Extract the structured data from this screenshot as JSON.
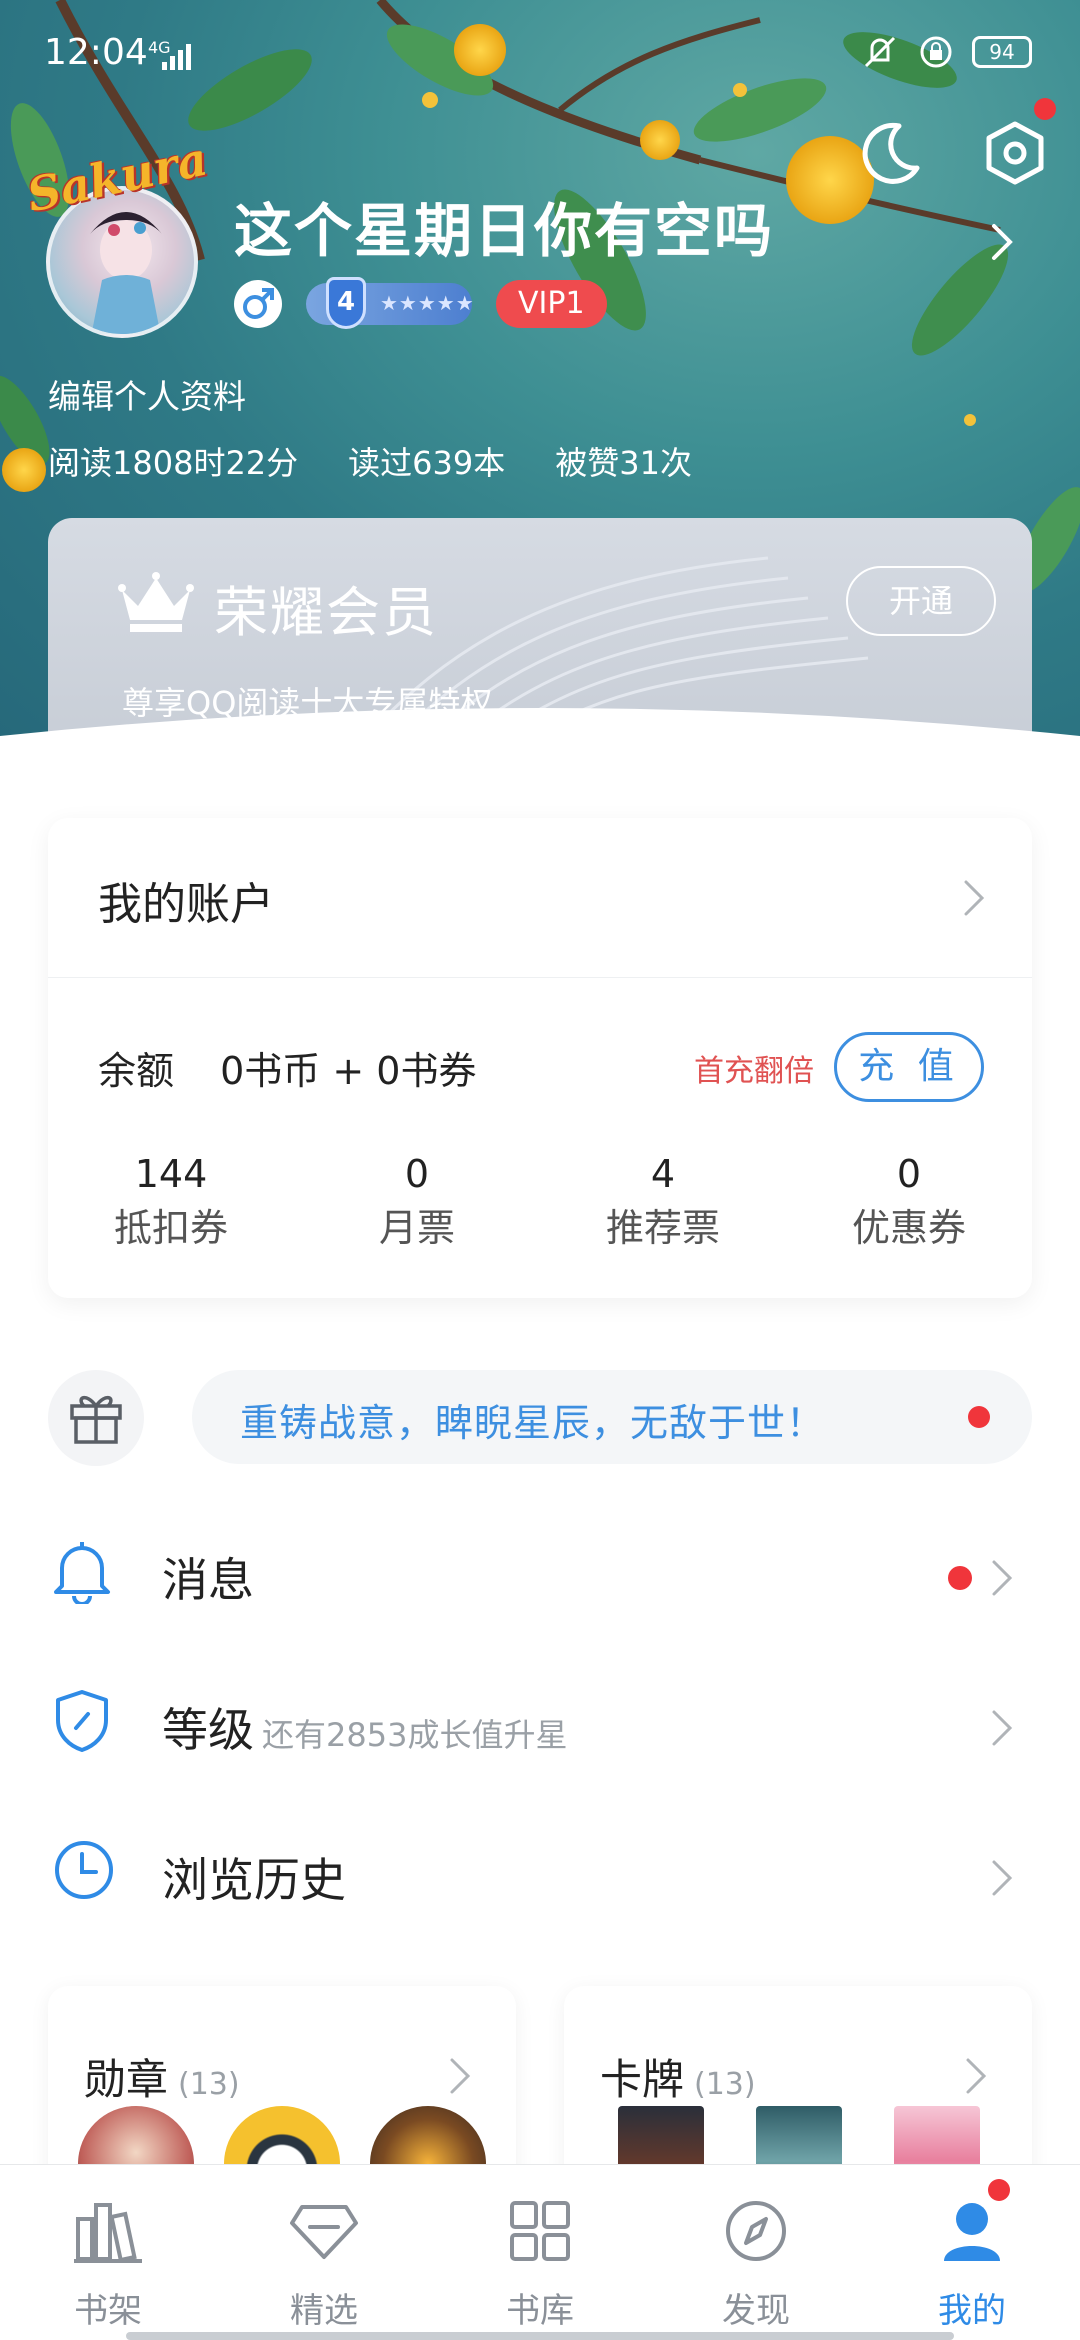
{
  "status_bar": {
    "time": "12:04",
    "network": "4G",
    "battery": "94"
  },
  "profile": {
    "avatar_overlay": "Sakura",
    "username": "这个星期日你有空吗",
    "level": "4",
    "level_stars": "★★★★★",
    "vip": "VIP1",
    "edit_profile": "编辑个人资料",
    "stats": {
      "read_time": "阅读1808时22分",
      "books_read": "读过639本",
      "likes": "被赞31次"
    }
  },
  "honor": {
    "title": "荣耀会员",
    "subtitle": "尊享QQ阅读十大专属特权",
    "button": "开通"
  },
  "account": {
    "title": "我的账户",
    "balance_label": "余额",
    "balance_value": "0书币 + 0书券",
    "first_double": "首充翻倍",
    "recharge": "充 值",
    "tickets": [
      {
        "num": "144",
        "label": "抵扣券"
      },
      {
        "num": "0",
        "label": "月票"
      },
      {
        "num": "4",
        "label": "推荐票"
      },
      {
        "num": "0",
        "label": "优惠券"
      }
    ]
  },
  "banner": {
    "text": "重铸战意，睥睨星辰，无敌于世！"
  },
  "menu": {
    "messages": {
      "label": "消息"
    },
    "level": {
      "label": "等级",
      "sub": "还有2853成长值升星"
    },
    "history": {
      "label": "浏览历史"
    }
  },
  "medals": {
    "title": "勋章",
    "count": "(13)"
  },
  "cards": {
    "title": "卡牌",
    "count": "(13)"
  },
  "nav": [
    {
      "label": "书架",
      "icon": "bookshelf-icon"
    },
    {
      "label": "精选",
      "icon": "diamond-icon"
    },
    {
      "label": "书库",
      "icon": "grid-icon"
    },
    {
      "label": "发现",
      "icon": "compass-icon"
    },
    {
      "label": "我的",
      "icon": "user-icon"
    }
  ],
  "colors": {
    "accent": "#2f8be6",
    "vip": "#ef4b4e",
    "red_dot": "#f0353b",
    "teal_bg": "#3e8f93"
  }
}
